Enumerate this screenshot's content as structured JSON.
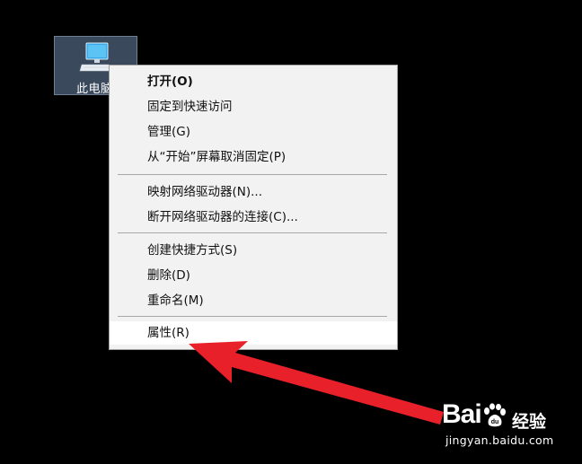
{
  "desktop": {
    "icon_label": "此电脑"
  },
  "context_menu": {
    "items": [
      {
        "label": "打开(O)",
        "bold": true
      },
      {
        "label": "固定到快速访问"
      },
      {
        "label": "管理(G)"
      },
      {
        "label": "从“开始”屏幕取消固定(P)"
      },
      {
        "label": "映射网络驱动器(N)..."
      },
      {
        "label": "断开网络驱动器的连接(C)..."
      },
      {
        "label": "创建快捷方式(S)"
      },
      {
        "label": "删除(D)"
      },
      {
        "label": "重命名(M)"
      },
      {
        "label": "属性(R)",
        "highlighted": true
      }
    ]
  },
  "annotation": {
    "arrow_color": "#e8202a"
  },
  "watermark": {
    "brand": "Bai",
    "brand_suffix": "经验",
    "url": "jingyan.baidu.com"
  },
  "icons": {
    "desktop_icon": "computer-icon",
    "watermark_icon": "baidu-paw-icon"
  }
}
